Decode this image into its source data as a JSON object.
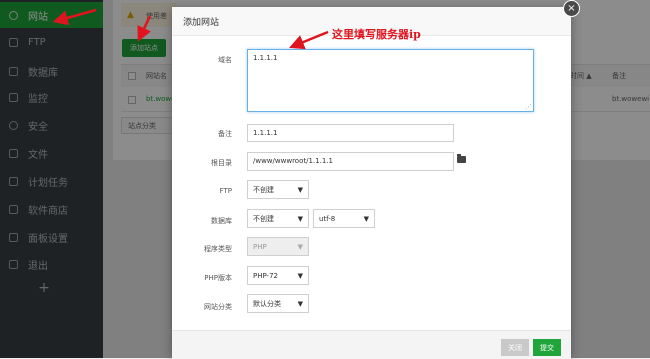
{
  "sidebar": {
    "items": [
      {
        "label": "网站",
        "icon": "globe-icon"
      },
      {
        "label": "FTP",
        "icon": "ftp-icon"
      },
      {
        "label": "数据库",
        "icon": "database-icon"
      },
      {
        "label": "监控",
        "icon": "monitor-icon"
      },
      {
        "label": "安全",
        "icon": "shield-icon"
      },
      {
        "label": "文件",
        "icon": "folder-icon"
      },
      {
        "label": "计划任务",
        "icon": "clock-icon"
      },
      {
        "label": "软件商店",
        "icon": "grid-icon"
      },
      {
        "label": "面板设置",
        "icon": "settings-icon"
      },
      {
        "label": "退出",
        "icon": "logout-icon"
      }
    ],
    "add_symbol": "+"
  },
  "background": {
    "warning_text": "使用差",
    "add_site_button": "添加站点",
    "table_headers": {
      "name": "网站名",
      "time": "时间 ▲",
      "note": "备注"
    },
    "row": {
      "name": "bt.wowe",
      "note": "bt.wowewi"
    },
    "category_label": "站点分类"
  },
  "dialog": {
    "title": "添加网站",
    "close_symbol": "×",
    "fields": {
      "domain_label": "域名",
      "domain_value": "1.1.1.1",
      "note_label": "备注",
      "note_value": "1.1.1.1",
      "root_label": "根目录",
      "root_value": "/www/wwwroot/1.1.1.1",
      "ftp_label": "FTP",
      "ftp_value": "不创建",
      "db_label": "数据库",
      "db_value": "不创建",
      "charset_value": "utf-8",
      "program_label": "程序类型",
      "program_value": "PHP",
      "php_label": "PHP版本",
      "php_value": "PHP-72",
      "category_label": "网站分类",
      "category_value": "默认分类"
    },
    "buttons": {
      "close": "关闭",
      "submit": "提交"
    }
  },
  "annotation": {
    "text": "这里填写服务器ip",
    "color": "#e0141e"
  },
  "colors": {
    "accent": "#20a53a",
    "sidebar": "#3a3f44",
    "annotation": "#e0141e"
  }
}
